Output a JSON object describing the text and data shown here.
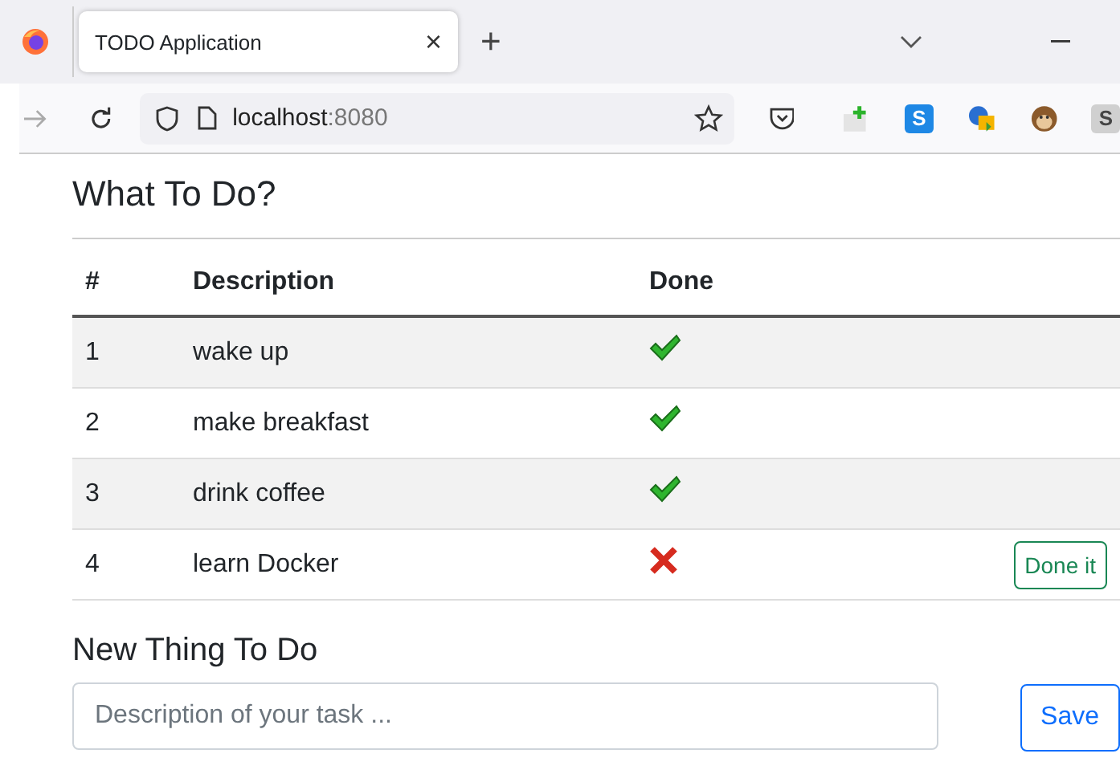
{
  "browser": {
    "tab": {
      "title": "TODO Application",
      "close": "×"
    },
    "new_tab": "+",
    "url": {
      "host": "localhost",
      "port": ":8080"
    },
    "extensions": [
      {
        "kind": "plus"
      },
      {
        "kind": "letter",
        "letter": "S",
        "color": "#1e88e5"
      },
      {
        "kind": "globe"
      },
      {
        "kind": "monkey"
      },
      {
        "kind": "letter",
        "letter": "S",
        "color": "#d0d0d0"
      }
    ]
  },
  "page": {
    "title": "What To Do?",
    "table": {
      "columns": [
        "#",
        "Description",
        "Done"
      ],
      "rows": [
        {
          "number": "1",
          "description": "wake up",
          "done": true
        },
        {
          "number": "2",
          "description": "make breakfast",
          "done": true
        },
        {
          "number": "3",
          "description": "drink coffee",
          "done": true
        },
        {
          "number": "4",
          "description": "learn Docker",
          "done": false,
          "action": "Done it"
        }
      ]
    },
    "new_title": "New Thing To Do",
    "input": {
      "placeholder": "Description of your task ..."
    },
    "save": "Save"
  }
}
